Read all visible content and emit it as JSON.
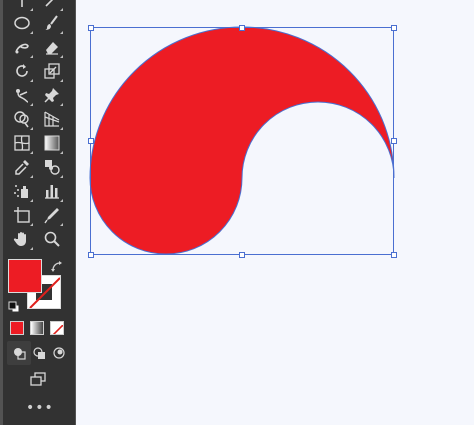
{
  "toolbar": {
    "tools": [
      {
        "name": "type-tool-icon"
      },
      {
        "name": "line-segment-tool-icon"
      },
      {
        "name": "ellipse-tool-icon"
      },
      {
        "name": "paintbrush-tool-icon"
      },
      {
        "name": "shaper-tool-icon"
      },
      {
        "name": "eraser-tool-icon"
      },
      {
        "name": "rotate-tool-icon"
      },
      {
        "name": "scale-tool-icon"
      },
      {
        "name": "puppet-warp-tool-icon"
      },
      {
        "name": "pin-tool-icon"
      },
      {
        "name": "shape-builder-tool-icon"
      },
      {
        "name": "perspective-grid-tool-icon"
      },
      {
        "name": "mesh-tool-icon"
      },
      {
        "name": "gradient-tool-icon"
      },
      {
        "name": "eyedropper-tool-icon"
      },
      {
        "name": "blend-tool-icon"
      },
      {
        "name": "symbol-sprayer-tool-icon"
      },
      {
        "name": "column-graph-tool-icon"
      },
      {
        "name": "artboard-tool-icon"
      },
      {
        "name": "slice-tool-icon"
      },
      {
        "name": "hand-tool-icon"
      },
      {
        "name": "zoom-tool-icon"
      }
    ],
    "fill_color": "#ed1c24",
    "stroke_color": "none",
    "more_label": "•••"
  },
  "canvas": {
    "shape_fill": "#ed1c24",
    "selection_color": "#4a6fd1"
  }
}
